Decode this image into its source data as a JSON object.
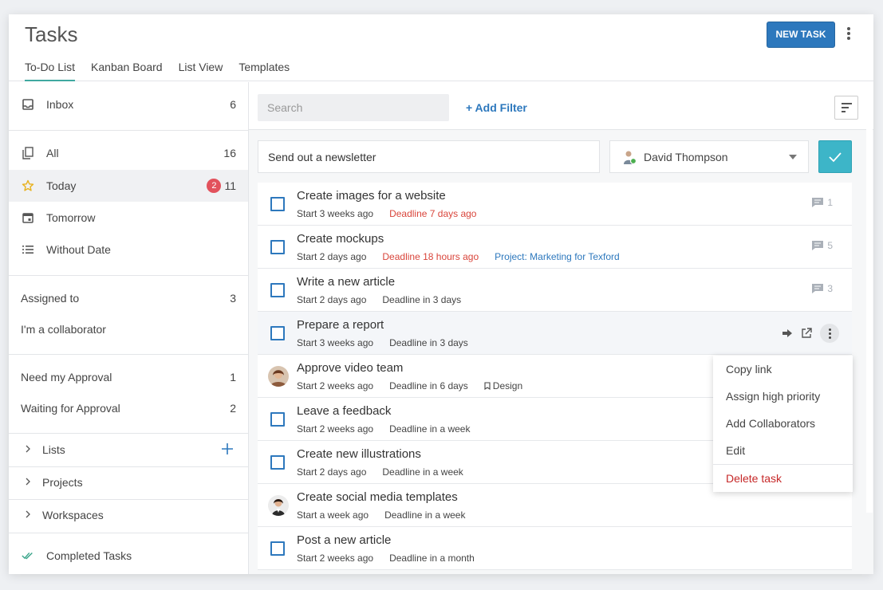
{
  "header": {
    "title": "Tasks",
    "new_task_label": "NEW TASK",
    "tabs": [
      "To-Do List",
      "Kanban Board",
      "List View",
      "Templates"
    ]
  },
  "sidebar": {
    "inbox": {
      "label": "Inbox",
      "count": "6"
    },
    "all": {
      "label": "All",
      "count": "16"
    },
    "today": {
      "label": "Today",
      "badge": "2",
      "count": "11"
    },
    "tomorrow": {
      "label": "Tomorrow"
    },
    "without_date": {
      "label": "Without Date"
    },
    "assigned_to": {
      "label": "Assigned to",
      "count": "3"
    },
    "collaborator": {
      "label": "I'm a collaborator"
    },
    "need_approval": {
      "label": "Need my Approval",
      "count": "1"
    },
    "waiting_approval": {
      "label": "Waiting for Approval",
      "count": "2"
    },
    "lists": {
      "label": "Lists"
    },
    "projects": {
      "label": "Projects"
    },
    "workspaces": {
      "label": "Workspaces"
    },
    "completed": {
      "label": "Completed Tasks"
    }
  },
  "toolbar": {
    "search_placeholder": "Search",
    "add_filter_label": "+ Add Filter"
  },
  "new_task": {
    "value": "Send out a newsletter",
    "assignee": "David Thompson"
  },
  "tasks": [
    {
      "title": "Create images for a website",
      "start": "Start 3 weeks ago",
      "deadline": "Deadline 7 days ago",
      "comments": "1"
    },
    {
      "title": "Create mockups",
      "start": "Start 2 days ago",
      "deadline": "Deadline 18 hours ago",
      "project": "Project: Marketing for Texford",
      "comments": "5"
    },
    {
      "title": "Write a new article",
      "start": "Start 2 days ago",
      "deadline": "Deadline in 3 days",
      "comments": "3"
    },
    {
      "title": "Prepare a report",
      "start": "Start 3 weeks ago",
      "deadline": "Deadline in 3 days"
    },
    {
      "title": "Approve video team",
      "start": "Start 2 weeks ago",
      "deadline": "Deadline in 6 days",
      "tag": "Design"
    },
    {
      "title": "Leave a feedback",
      "start": "Start 2 weeks ago",
      "deadline": "Deadline in a week"
    },
    {
      "title": "Create new illustrations",
      "start": "Start 2 days ago",
      "deadline": "Deadline in a week"
    },
    {
      "title": "Create social media templates",
      "start": "Start a week ago",
      "deadline": "Deadline in a week"
    },
    {
      "title": "Post a new article",
      "start": "Start 2 weeks ago",
      "deadline": "Deadline in a month"
    }
  ],
  "context_menu": {
    "copy_link": "Copy link",
    "high_priority": "Assign high priority",
    "add_collaborators": "Add Collaborators",
    "edit": "Edit",
    "delete": "Delete task"
  },
  "colors": {
    "accent": "#2d78bd",
    "confirm": "#3db5c8",
    "deadline_overdue": "#d9453b",
    "badge": "#e2525c",
    "delete": "#c62828"
  },
  "icons": [
    "inbox-icon",
    "copy-icon",
    "star-icon",
    "calendar-icon",
    "list-icon",
    "chevron-right-icon",
    "plus-icon",
    "double-check-icon",
    "comment-icon",
    "arrow-right-icon",
    "external-link-icon",
    "more-vertical-icon",
    "bookmark-icon",
    "check-icon",
    "sort-icon"
  ]
}
